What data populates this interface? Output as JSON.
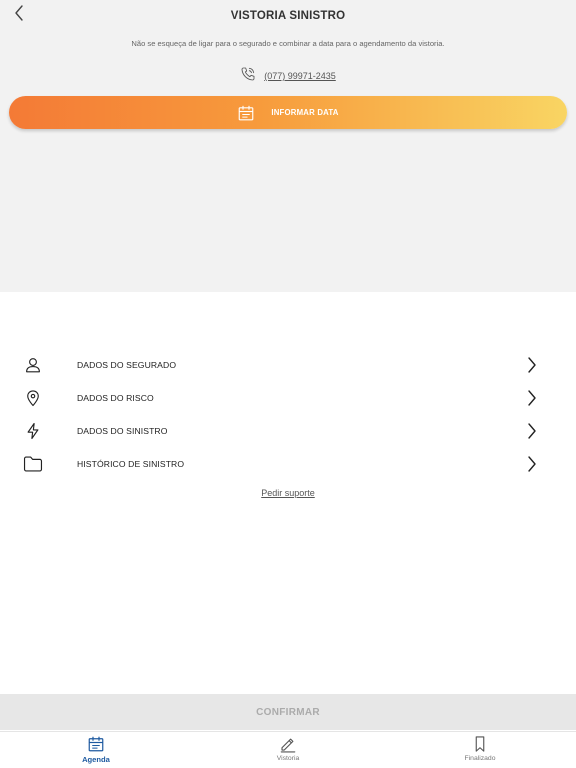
{
  "header": {
    "title": "VISTORIA SINISTRO",
    "back_icon": "chevron-left-icon"
  },
  "notice": {
    "text": "Não se esqueça de ligar para o segurado e combinar a data para o agendamento da vistoria.",
    "phone_icon": "phone-icon",
    "phone_number": "(077) 99971-2435"
  },
  "date_button": {
    "label": "INFORMAR DATA",
    "icon": "calendar-icon"
  },
  "menu": {
    "items": [
      {
        "label": "DADOS DO SEGURADO",
        "icon": "user-icon"
      },
      {
        "label": "DADOS DO RISCO",
        "icon": "map-pin-icon"
      },
      {
        "label": "DADOS DO SINISTRO",
        "icon": "lightning-icon"
      },
      {
        "label": "HISTÓRICO DE SINISTRO",
        "icon": "folder-icon"
      }
    ]
  },
  "support_link": "Pedir suporte",
  "confirm_label": "CONFIRMAR",
  "bottom_nav": {
    "tabs": [
      {
        "label": "Agenda",
        "icon": "calendar-icon",
        "active": true
      },
      {
        "label": "Vistoria",
        "icon": "pencil-icon",
        "active": false
      },
      {
        "label": "Finalizado",
        "icon": "bookmark-icon",
        "active": false
      }
    ]
  },
  "colors": {
    "gradient_start": "#f47a36",
    "gradient_end": "#f9d563",
    "active_tab": "#1e5aa0",
    "panel_background": "#f2f2f2"
  }
}
